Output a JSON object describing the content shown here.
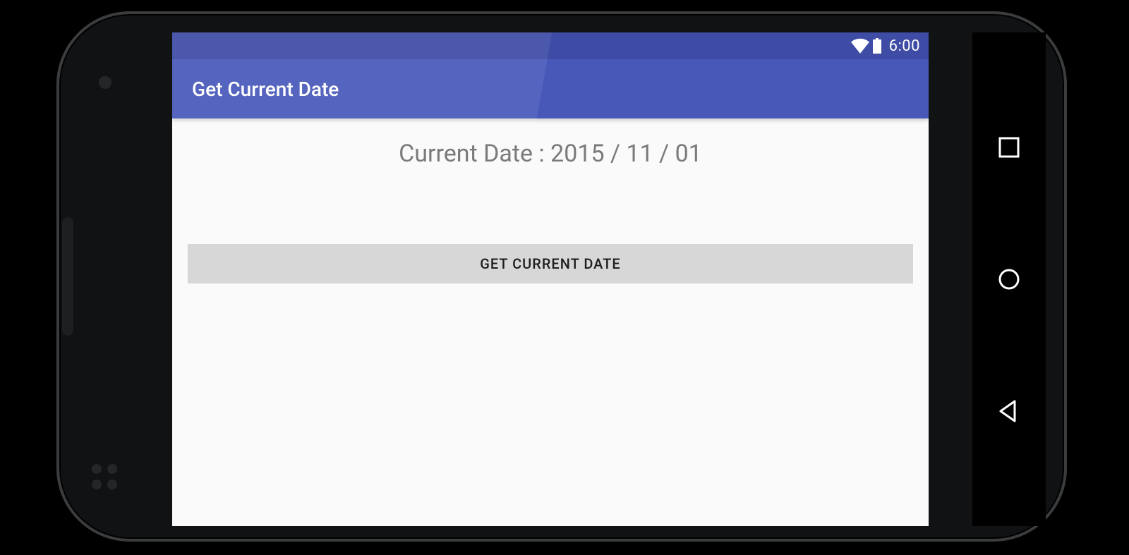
{
  "statusbar": {
    "time": "6:00"
  },
  "appbar": {
    "title": "Get Current Date"
  },
  "main": {
    "date_text": "Current Date : 2015 / 11 / 01",
    "button_label": "GET CURRENT DATE"
  },
  "colors": {
    "primary": "#4455b8",
    "primary_dark": "#3a48a3",
    "background": "#fafafa",
    "button_bg": "#d6d7d6"
  }
}
